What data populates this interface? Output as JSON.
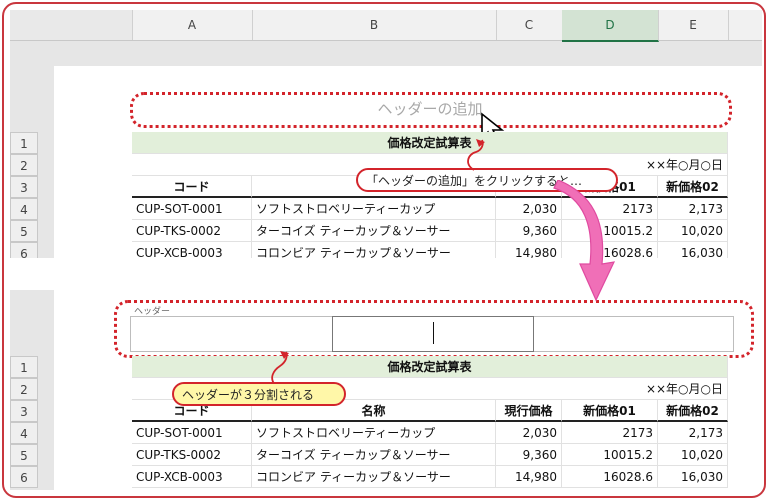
{
  "columns": [
    "A",
    "B",
    "C",
    "D",
    "E"
  ],
  "rows": [
    "1",
    "2",
    "3",
    "4",
    "5",
    "6"
  ],
  "table": {
    "title": "価格改定試算表",
    "date": "××年○月○日",
    "headers": [
      "コード",
      "名称",
      "現行価格",
      "新価格01",
      "新価格02"
    ],
    "data": [
      [
        "CUP-SOT-0001",
        "ソフトストロベリーティーカップ",
        "2,030",
        "2173",
        "2,173"
      ],
      [
        "CUP-TKS-0002",
        "ターコイズ ティーカップ＆ソーサー",
        "9,360",
        "10015.2",
        "10,020"
      ],
      [
        "CUP-XCB-0003",
        "コロンビア ティーカップ＆ソーサー",
        "14,980",
        "16028.6",
        "16,030"
      ]
    ]
  },
  "top": {
    "header_placeholder": "ヘッダーの追加",
    "callout": "「ヘッダーの追加」をクリックすると…",
    "partial_header_03": "新価格01",
    "partial_header_04": "新価格02"
  },
  "bottom": {
    "header_label": "ヘッダー",
    "callout": "ヘッダーが３分割される"
  },
  "colors": {
    "accent": "#d3242b",
    "highlight": "#e2efda",
    "callout_fill": "#fff7a8",
    "arrow": "#f06fb7"
  }
}
